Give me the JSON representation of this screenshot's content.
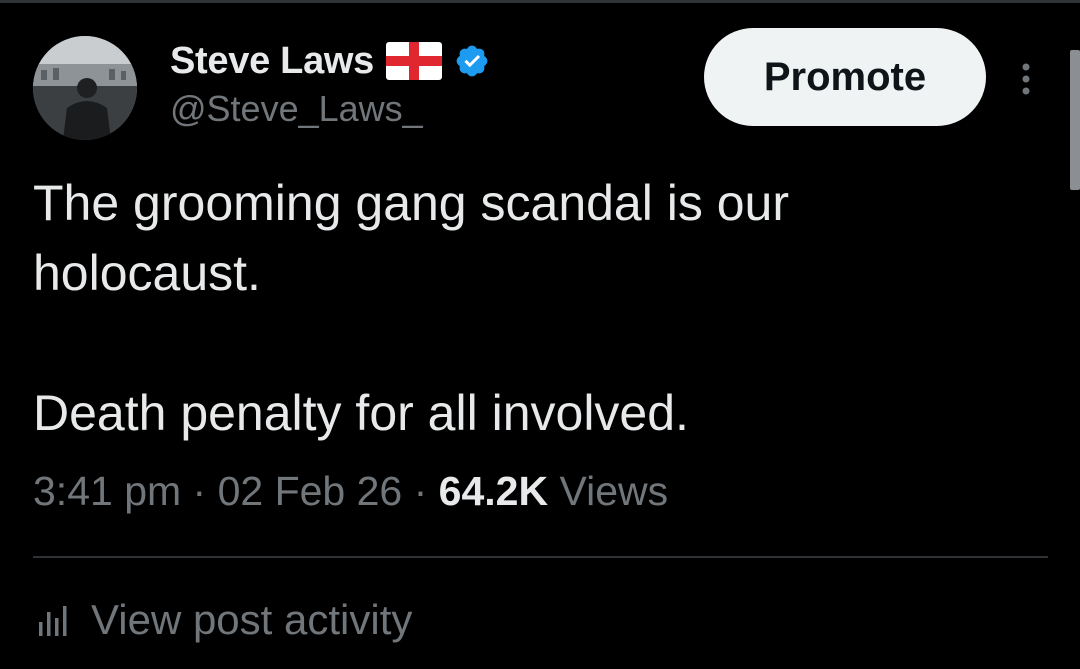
{
  "author": {
    "name": "Steve Laws",
    "handle": "@Steve_Laws_",
    "flag_icon": "england-flag-icon",
    "verified_icon": "verified-badge-icon",
    "verified_color": "#1d9bf0"
  },
  "actions": {
    "promote_label": "Promote",
    "more_icon": "vertical-ellipsis-icon"
  },
  "post": {
    "line1": "The grooming gang scandal is our",
    "line2": "holocaust.",
    "line3": "Death penalty for all involved."
  },
  "meta": {
    "time": "3:41 pm",
    "sep1": " · ",
    "date": "02 Feb 26",
    "sep2": " · ",
    "views_count": "64.2K",
    "views_label": " Views"
  },
  "activity": {
    "icon": "bar-chart-icon",
    "label": "View post activity"
  },
  "colors": {
    "background": "#000000",
    "text_primary": "#e7e9ea",
    "text_secondary": "#71767b",
    "button_bg": "#eff3f4",
    "divider": "#2f3336"
  }
}
